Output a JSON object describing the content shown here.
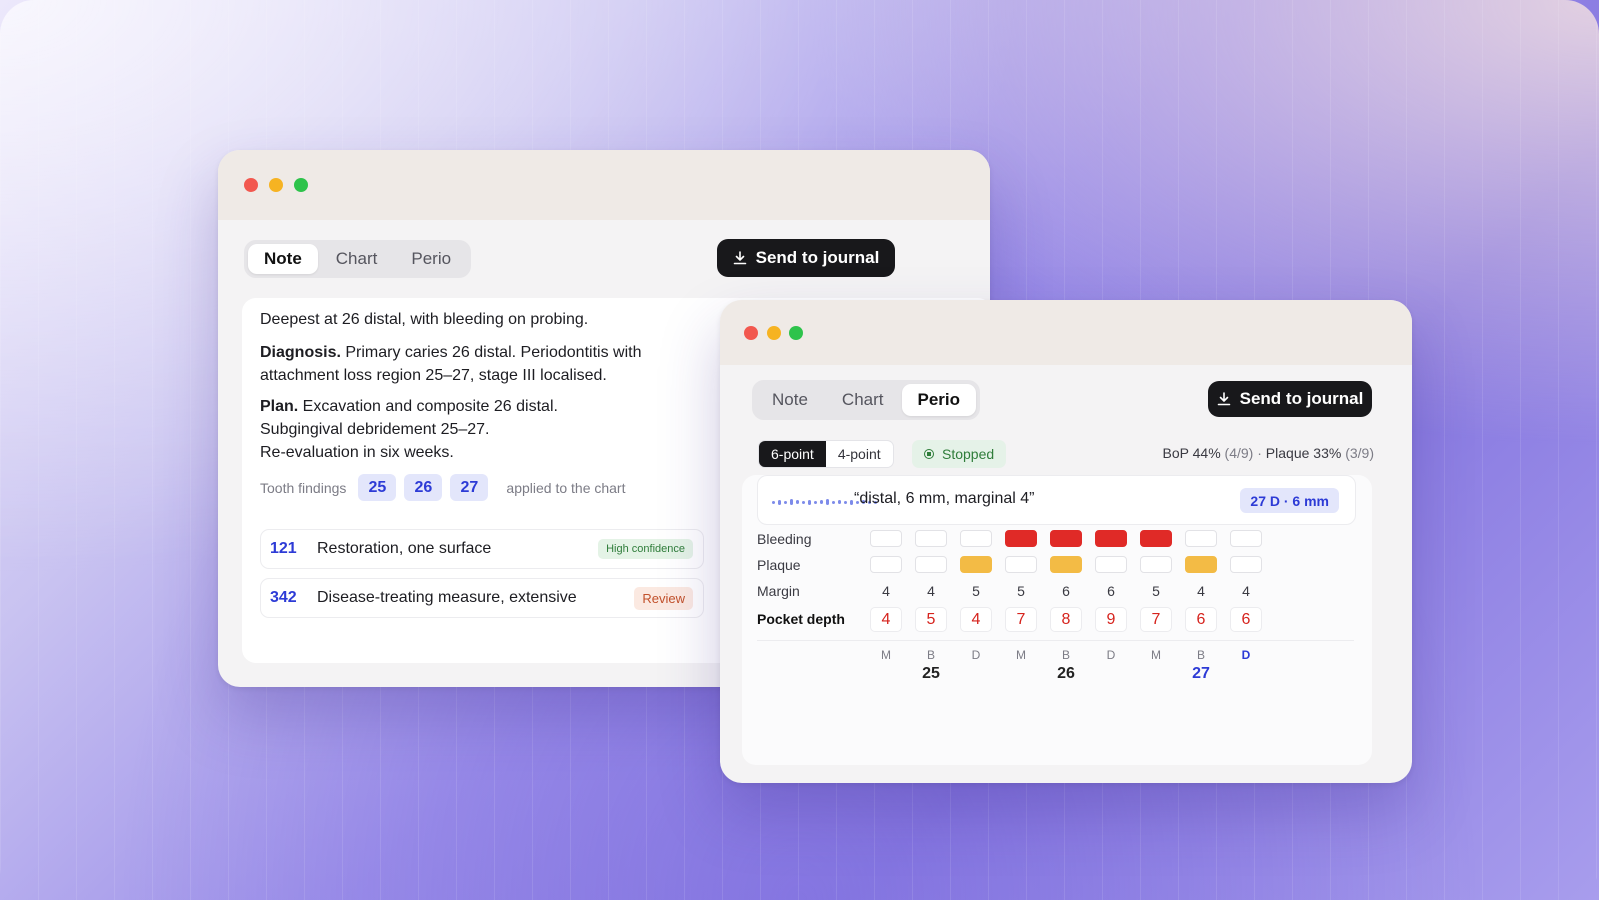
{
  "window_back": {
    "tabs": [
      "Note",
      "Chart",
      "Perio"
    ],
    "active_tab": "Note",
    "send_label": "Send to journal",
    "note": {
      "line1": "Deepest at 26 distal, with bleeding on probing.",
      "diagnosis_label": "Diagnosis.",
      "diagnosis_text": " Primary caries 26 distal. Periodontitis with",
      "diagnosis_text2": "attachment loss region 25–27, stage III localised.",
      "plan_label": "Plan.",
      "plan_text": " Excavation and composite 26 distal.",
      "plan_line2": "Subgingival debridement 25–27.",
      "plan_line3": "Re-evaluation in six weeks."
    },
    "findings_label": "Tooth findings",
    "findings_teeth": [
      "25",
      "26",
      "27"
    ],
    "findings_suffix": "applied to the chart",
    "codes": [
      {
        "code": "121",
        "desc": "Restoration, one surface",
        "badge": "High confidence",
        "badge_kind": "green"
      },
      {
        "code": "342",
        "desc": "Disease-treating measure, extensive",
        "badge": "Review",
        "badge_kind": "orange"
      }
    ]
  },
  "window_front": {
    "tabs": [
      "Note",
      "Chart",
      "Perio"
    ],
    "active_tab": "Perio",
    "send_label": "Send to journal",
    "modes": [
      "6-point",
      "4-point"
    ],
    "active_mode": "6-point",
    "status": "Stopped",
    "stats": {
      "bop": "BoP 44%",
      "bop_count": "(4/9)",
      "sep": "·",
      "plaque": "Plaque 33%",
      "plaque_count": "(3/9)"
    },
    "transcript": "“distal, 6 mm, marginal 4”",
    "location": "27 D · 6 mm",
    "row_labels": {
      "bleeding": "Bleeding",
      "plaque": "Plaque",
      "margin": "Margin",
      "pocket": "Pocket depth"
    },
    "bleeding": [
      0,
      0,
      0,
      1,
      1,
      1,
      1,
      0,
      0
    ],
    "plaque": [
      0,
      0,
      1,
      0,
      1,
      0,
      0,
      1,
      0
    ],
    "margin": [
      "4",
      "4",
      "5",
      "5",
      "6",
      "6",
      "5",
      "4",
      "4"
    ],
    "pocket_depth": [
      "4",
      "5",
      "4",
      "7",
      "8",
      "9",
      "7",
      "6",
      "6"
    ],
    "surfaces": [
      "M",
      "B",
      "D",
      "M",
      "B",
      "D",
      "M",
      "B",
      "D"
    ],
    "active_surface_index": 8,
    "teeth": [
      "25",
      "26",
      "27"
    ],
    "active_tooth": "27",
    "colors": {
      "bleeding": "#e02a27",
      "plaque": "#f3bb45",
      "accent": "#2d3bd6"
    }
  }
}
